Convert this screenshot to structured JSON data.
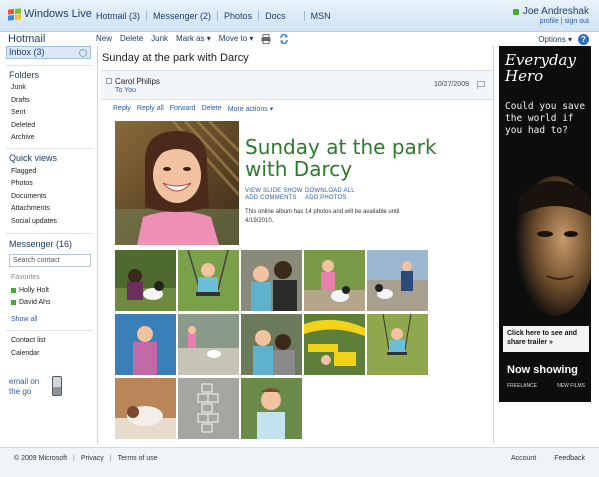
{
  "topbar": {
    "brand": "Windows Live",
    "nav": [
      "Hotmail (3)",
      "Messenger (2)",
      "Photos",
      "Docs",
      "MSN"
    ],
    "user_name": "Joe Andreshak",
    "profile_link": "profile",
    "signout_link": "sign out"
  },
  "toolbar": {
    "app_title": "Hotmail",
    "new": "New",
    "delete": "Delete",
    "junk": "Junk",
    "mark_as": "Mark as ▾",
    "move_to": "Move to ▾",
    "options": "Options ▾",
    "help": "?"
  },
  "sidebar": {
    "inbox": "Inbox (3)",
    "folders_head": "Folders",
    "folders": [
      "Junk",
      "Drafts",
      "Sent",
      "Deleted",
      "Archive"
    ],
    "quick_head": "Quick views",
    "quick": [
      "Flagged",
      "Photos",
      "Documents",
      "Attachments",
      "Social updates"
    ],
    "messenger_head": "Messenger (16)",
    "search_placeholder": "Search contact",
    "favorites_label": "Favorites",
    "favorites": [
      "Holly Holt",
      "David Ahs"
    ],
    "show_all": "Show all",
    "contact_list": "Contact list",
    "calendar": "Calendar",
    "email_go_line1": "email on",
    "email_go_line2": "the go"
  },
  "message": {
    "subject": "Sunday at the park with Darcy",
    "from": "Carol Philips",
    "to": "To You",
    "date": "10/27/2009",
    "actions": [
      "Reply",
      "Reply all",
      "Forward",
      "Delete",
      "More actions ▾"
    ]
  },
  "album": {
    "title": "Sunday at the park with Darcy",
    "view_slideshow": "VIEW SLIDE SHOW",
    "download_all": "DOWNLOAD ALL",
    "add_comments": "ADD COMMENTS",
    "add_photos": "ADD PHOTOS",
    "description": "This online album has 14 photos and will be available until 4/19/2010."
  },
  "ad": {
    "title_line1": "Everyday",
    "title_line2": "Hero",
    "sub": "Could you save the world if you had to?",
    "cta": "Click here to see and share trailer »",
    "now_showing": "Now showing",
    "credit_left": "FREELANCE",
    "credit_right": "NEW FILMS"
  },
  "footer": {
    "copyright": "© 2009 Microsoft",
    "privacy": "Privacy",
    "terms": "Terms of use",
    "account": "Account",
    "feedback": "Feedback"
  },
  "colors": {
    "accent_blue": "#2a5db0",
    "album_green": "#2d7a2d",
    "presence_green": "#3fae2a"
  }
}
